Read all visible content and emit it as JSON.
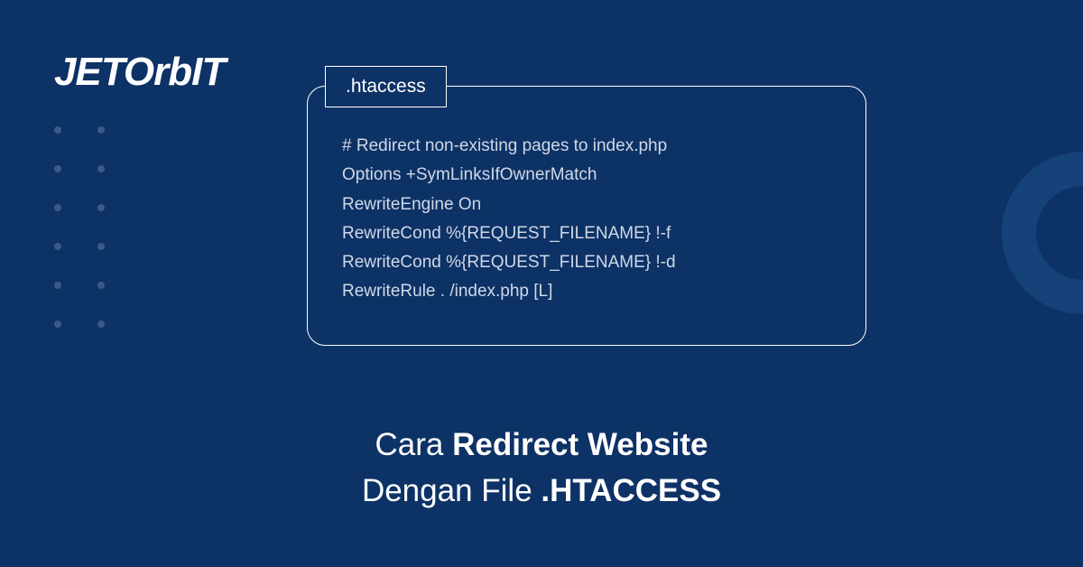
{
  "logo": {
    "text": "JETOrbIT"
  },
  "codeBlock": {
    "label": ".htaccess",
    "lines": [
      "# Redirect non-existing pages to index.php",
      "Options +SymLinksIfOwnerMatch",
      "RewriteEngine On",
      "RewriteCond %{REQUEST_FILENAME} !-f",
      "RewriteCond %{REQUEST_FILENAME} !-d",
      "RewriteRule . /index.php [L]"
    ]
  },
  "title": {
    "line1_light": "Cara ",
    "line1_bold": "Redirect Website",
    "line2_light": "Dengan File ",
    "line2_bold": ".HTACCESS"
  }
}
